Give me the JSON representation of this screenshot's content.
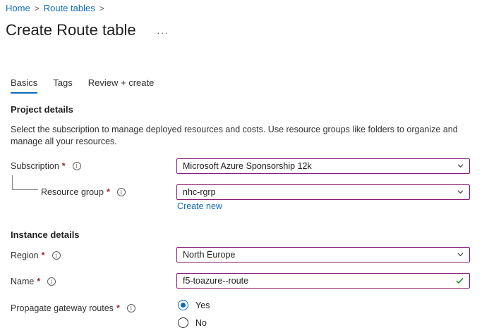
{
  "breadcrumb": {
    "home": "Home",
    "route_tables": "Route tables",
    "separator": ">"
  },
  "page": {
    "title": "Create Route table",
    "more": "···"
  },
  "tabs": [
    {
      "label": "Basics",
      "active": true
    },
    {
      "label": "Tags",
      "active": false
    },
    {
      "label": "Review + create",
      "active": false
    }
  ],
  "project": {
    "title": "Project details",
    "description": "Select the subscription to manage deployed resources and costs. Use resource groups like folders to organize and manage all your resources.",
    "subscription": {
      "label": "Subscription",
      "value": "Microsoft Azure Sponsorship 12k"
    },
    "resource_group": {
      "label": "Resource group",
      "value": "nhc-rgrp",
      "create_new": "Create new"
    }
  },
  "instance": {
    "title": "Instance details",
    "region": {
      "label": "Region",
      "value": "North Europe"
    },
    "name": {
      "label": "Name",
      "value": "f5-toazure--route"
    },
    "propagate": {
      "label": "Propagate gateway routes",
      "options": [
        "Yes",
        "No"
      ],
      "selected": "Yes"
    }
  },
  "required_mark": "*",
  "info_glyph": "i",
  "colors": {
    "link": "#0f6cbd",
    "field_border": "#8a1f7a",
    "required": "#a4262c",
    "valid": "#107c10"
  }
}
